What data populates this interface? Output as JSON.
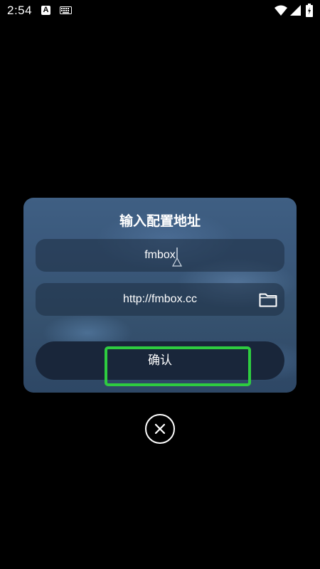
{
  "status_bar": {
    "time": "2:54",
    "icons": [
      "a-icon",
      "keyboard-icon",
      "wifi-icon",
      "signal-icon",
      "battery-icon"
    ],
    "a_label": "A"
  },
  "dialog": {
    "title": "输入配置地址",
    "name_field": {
      "value": "fmbox"
    },
    "url_field": {
      "value": "http://fmbox.cc"
    },
    "folder_icon": "folder-icon",
    "confirm_label": "确认"
  },
  "close_icon": "close-icon",
  "colors": {
    "highlight": "#2ecc40",
    "button_bg": "#19263a",
    "dialog_bg": "#3a587b"
  }
}
